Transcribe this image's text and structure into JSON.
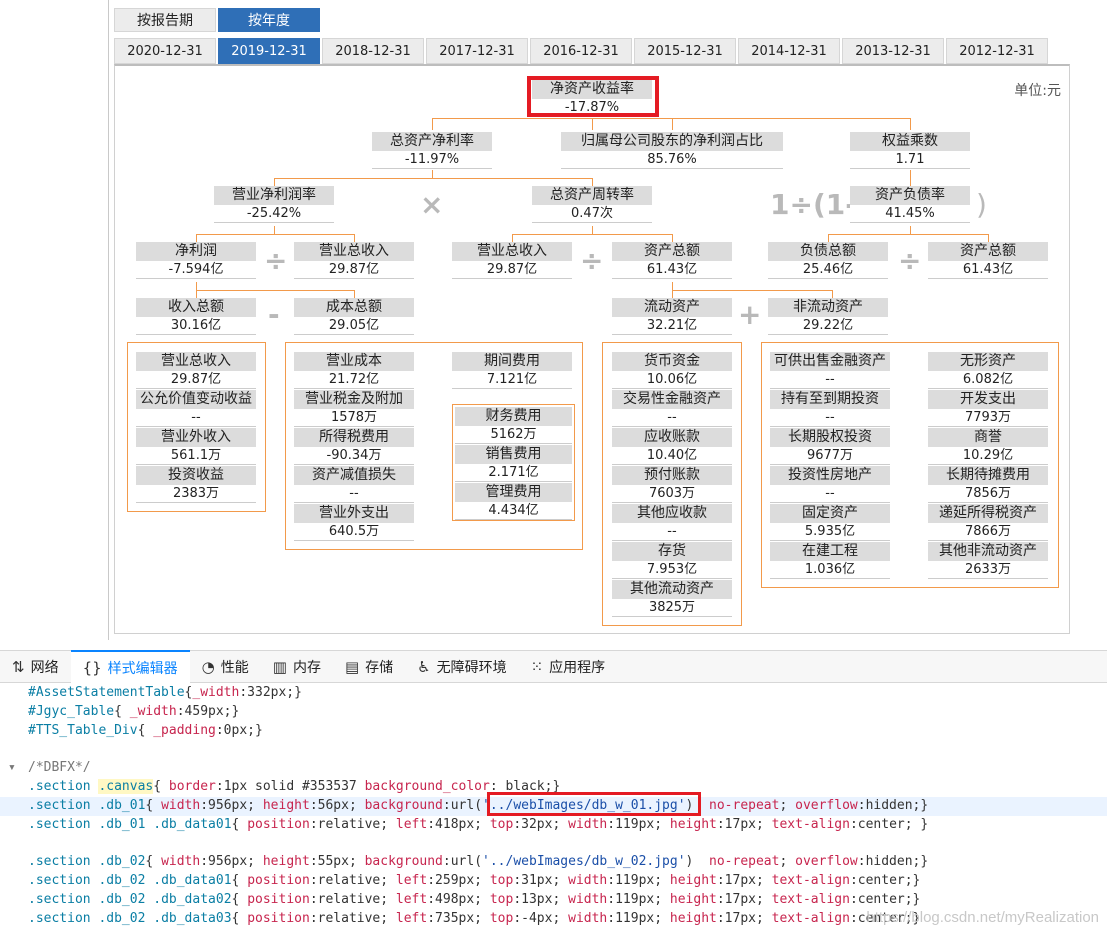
{
  "report_tabs": [
    {
      "label": "按报告期",
      "active": false
    },
    {
      "label": "按年度",
      "active": true
    }
  ],
  "year_tabs": [
    {
      "label": "2020-12-31",
      "active": false
    },
    {
      "label": "2019-12-31",
      "active": true
    },
    {
      "label": "2018-12-31",
      "active": false
    },
    {
      "label": "2017-12-31",
      "active": false
    },
    {
      "label": "2016-12-31",
      "active": false
    },
    {
      "label": "2015-12-31",
      "active": false
    },
    {
      "label": "2014-12-31",
      "active": false
    },
    {
      "label": "2013-12-31",
      "active": false
    },
    {
      "label": "2012-12-31",
      "active": false
    }
  ],
  "unit_label": "单位:元",
  "operators": {
    "times": "×",
    "divide": "÷",
    "minus": "-",
    "plus": "+",
    "one_div": "1÷(1-",
    "close_paren": ")"
  },
  "nodes": {
    "roe": {
      "label": "净资产收益率",
      "value": "-17.87%"
    },
    "roa": {
      "label": "总资产净利率",
      "value": "-11.97%"
    },
    "parent_ratio": {
      "label": "归属母公司股东的净利润占比",
      "value": "85.76%"
    },
    "equity_mult": {
      "label": "权益乘数",
      "value": "1.71"
    },
    "op_margin": {
      "label": "营业净利润率",
      "value": "-25.42%"
    },
    "turnover": {
      "label": "总资产周转率",
      "value": "0.47次"
    },
    "debt_ratio": {
      "label": "资产负债率",
      "value": "41.45%"
    },
    "net_profit": {
      "label": "净利润",
      "value": "-7.594亿"
    },
    "revenue1": {
      "label": "营业总收入",
      "value": "29.87亿"
    },
    "revenue2": {
      "label": "营业总收入",
      "value": "29.87亿"
    },
    "total_assets1": {
      "label": "资产总额",
      "value": "61.43亿"
    },
    "total_debt": {
      "label": "负债总额",
      "value": "25.46亿"
    },
    "total_assets2": {
      "label": "资产总额",
      "value": "61.43亿"
    },
    "income_total": {
      "label": "收入总额",
      "value": "30.16亿"
    },
    "cost_total": {
      "label": "成本总额",
      "value": "29.05亿"
    },
    "current_assets": {
      "label": "流动资产",
      "value": "32.21亿"
    },
    "noncurrent_assets": {
      "label": "非流动资产",
      "value": "29.22亿"
    }
  },
  "groups": {
    "income": [
      {
        "label": "营业总收入",
        "value": "29.87亿"
      },
      {
        "label": "公允价值变动收益",
        "value": "--"
      },
      {
        "label": "营业外收入",
        "value": "561.1万"
      },
      {
        "label": "投资收益",
        "value": "2383万"
      }
    ],
    "cost": [
      {
        "label": "营业成本",
        "value": "21.72亿"
      },
      {
        "label": "营业税金及附加",
        "value": "1578万"
      },
      {
        "label": "所得税费用",
        "value": "-90.34万"
      },
      {
        "label": "资产减值损失",
        "value": "--"
      },
      {
        "label": "营业外支出",
        "value": "640.5万"
      }
    ],
    "period_expense": {
      "label": "期间费用",
      "value": "7.121亿"
    },
    "expenses": [
      {
        "label": "财务费用",
        "value": "5162万"
      },
      {
        "label": "销售费用",
        "value": "2.171亿"
      },
      {
        "label": "管理费用",
        "value": "4.434亿"
      }
    ],
    "current": [
      {
        "label": "货币资金",
        "value": "10.06亿"
      },
      {
        "label": "交易性金融资产",
        "value": "--"
      },
      {
        "label": "应收账款",
        "value": "10.40亿"
      },
      {
        "label": "预付账款",
        "value": "7603万"
      },
      {
        "label": "其他应收款",
        "value": "--"
      },
      {
        "label": "存货",
        "value": "7.953亿"
      },
      {
        "label": "其他流动资产",
        "value": "3825万"
      }
    ],
    "noncurrent_left": [
      {
        "label": "可供出售金融资产",
        "value": "--"
      },
      {
        "label": "持有至到期投资",
        "value": "--"
      },
      {
        "label": "长期股权投资",
        "value": "9677万"
      },
      {
        "label": "投资性房地产",
        "value": "--"
      },
      {
        "label": "固定资产",
        "value": "5.935亿"
      },
      {
        "label": "在建工程",
        "value": "1.036亿"
      }
    ],
    "noncurrent_right": [
      {
        "label": "无形资产",
        "value": "6.082亿"
      },
      {
        "label": "开发支出",
        "value": "7793万"
      },
      {
        "label": "商誉",
        "value": "10.29亿"
      },
      {
        "label": "长期待摊费用",
        "value": "7856万"
      },
      {
        "label": "递延所得税资产",
        "value": "7866万"
      },
      {
        "label": "其他非流动资产",
        "value": "2633万"
      }
    ]
  },
  "devtools": {
    "tabs": [
      {
        "label": "网络",
        "icon": "network-arrow-icon",
        "glyph": "⇅",
        "active": false
      },
      {
        "label": "样式编辑器",
        "icon": "braces-icon",
        "glyph": "{}",
        "active": true
      },
      {
        "label": "性能",
        "icon": "gauge-icon",
        "glyph": "◔",
        "active": false
      },
      {
        "label": "内存",
        "icon": "memory-chip-icon",
        "glyph": "▥",
        "active": false
      },
      {
        "label": "存储",
        "icon": "storage-icon",
        "glyph": "▤",
        "active": false
      },
      {
        "label": "无障碍环境",
        "icon": "accessibility-person-icon",
        "glyph": "♿",
        "active": false
      },
      {
        "label": "应用程序",
        "icon": "app-grid-icon",
        "glyph": "⁙",
        "active": false
      }
    ],
    "code_lines": [
      "#AssetStatementTable{_width:332px;}",
      "#Jgyc_Table{ _width:459px;}",
      "#TTS_Table_Div{ _padding:0px;}",
      "",
      "/*DBFX*/",
      ".section .canvas{ border:1px solid #353537 background_color: black;}",
      ".section .db_01{ width:956px; height:56px; background:url('../webImages/db_w_01.jpg')  no-repeat; overflow:hidden;}",
      ".section .db_01 .db_data01{ position:relative; left:418px; top:32px; width:119px; height:17px; text-align:center; }",
      "",
      ".section .db_02{ width:956px; height:55px; background:url('../webImages/db_w_02.jpg')  no-repeat; overflow:hidden;}",
      ".section .db_02 .db_data01{ position:relative; left:259px; top:31px; width:119px; height:17px; text-align:center;}",
      ".section .db_02 .db_data02{ position:relative; left:498px; top:13px; width:119px; height:17px; text-align:center;}",
      ".section .db_02 .db_data03{ position:relative; left:735px; top:-4px; width:119px; height:17px; text-align:center;}"
    ],
    "watermark": "https://blog.csdn.net/myRealization"
  }
}
